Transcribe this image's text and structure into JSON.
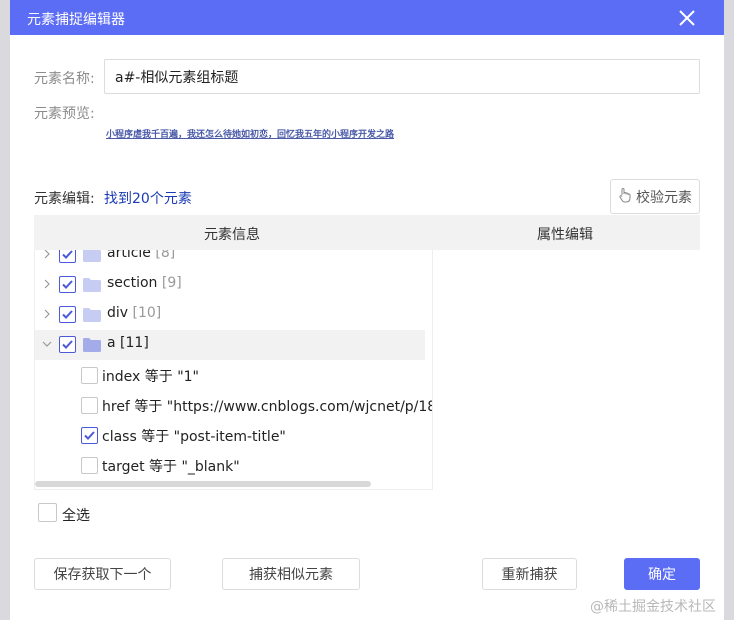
{
  "dialog": {
    "title": "元素捕捉编辑器"
  },
  "form": {
    "name_label": "元素名称:",
    "name_value": "a#-相似元素组标题",
    "preview_label": "元素预览:",
    "preview_text": "小程序虐我千百遍，我还怎么待她如初恋，回忆我五年的小程序开发之路",
    "edit_label": "元素编辑:",
    "found_text": "找到20个元素",
    "verify_button": "校验元素"
  },
  "table": {
    "col_info": "元素信息",
    "col_attr": "属性编辑"
  },
  "tree": {
    "nodes": [
      {
        "label": "article",
        "count": "[8]"
      },
      {
        "label": "section",
        "count": "[9]"
      },
      {
        "label": "div",
        "count": "[10]"
      },
      {
        "label": "a",
        "count": "[11]"
      }
    ],
    "attributes": [
      {
        "text": "index 等于 \"1\"",
        "checked": false
      },
      {
        "text": "href 等于 \"https://www.cnblogs.com/wjcnet/p/18",
        "checked": false
      },
      {
        "text": "class 等于 \"post-item-title\"",
        "checked": true
      },
      {
        "text": "target 等于 \"_blank\"",
        "checked": false
      }
    ]
  },
  "select_all_label": "全选",
  "buttons": {
    "save_next": "保存获取下一个",
    "capture_similar": "捕获相似元素",
    "recapture": "重新捕获",
    "confirm": "确定"
  },
  "watermark": "@稀土掘金技术社区",
  "colors": {
    "accent": "#5b6cf5",
    "link": "#1a3bb5"
  }
}
